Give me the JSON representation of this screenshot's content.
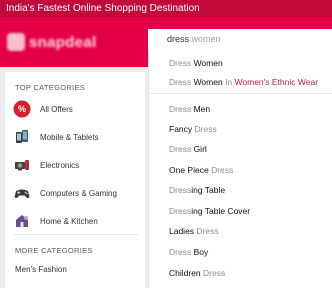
{
  "topbar": {
    "tagline": "India's Fastest Online Shopping Destination"
  },
  "brand": {
    "logo_text": "snapdeal"
  },
  "sidebar": {
    "top_heading": "TOP CATEGORIES",
    "categories": [
      {
        "label": "All Offers",
        "icon": "percent-offer-icon"
      },
      {
        "label": "Mobile & Tablets",
        "icon": "mobile-phone-icon"
      },
      {
        "label": "Electronics",
        "icon": "electronics-icon"
      },
      {
        "label": "Computers & Gaming",
        "icon": "gamepad-icon"
      },
      {
        "label": "Home & Kitchen",
        "icon": "home-kitchen-icon"
      }
    ],
    "more_heading": "MORE CATEGORIES",
    "more_items": [
      "Men's Fashion"
    ]
  },
  "search": {
    "value": "dress",
    "typed": "dress",
    "completion": " women"
  },
  "suggestions": {
    "items": [
      {
        "parts": [
          {
            "t": "Dress",
            "s": "g"
          },
          {
            "t": " Women",
            "s": "b"
          }
        ]
      },
      {
        "parts": [
          {
            "t": "Dress",
            "s": "g"
          },
          {
            "t": " Women",
            "s": "b"
          },
          {
            "t": " In ",
            "s": "g"
          },
          {
            "t": "Women's Ethnic Wear",
            "s": "p"
          }
        ]
      },
      {
        "parts": [
          {
            "t": "Dress",
            "s": "g"
          },
          {
            "t": " Men",
            "s": "b"
          }
        ]
      },
      {
        "parts": [
          {
            "t": "Fancy",
            "s": "b"
          },
          {
            "t": " Dress",
            "s": "g"
          }
        ]
      },
      {
        "parts": [
          {
            "t": "Dress",
            "s": "g"
          },
          {
            "t": " Girl",
            "s": "b"
          }
        ]
      },
      {
        "parts": [
          {
            "t": "One Piece",
            "s": "b"
          },
          {
            "t": " Dress",
            "s": "g"
          }
        ]
      },
      {
        "parts": [
          {
            "t": "Dress",
            "s": "g"
          },
          {
            "t": "ing Table",
            "s": "b"
          }
        ]
      },
      {
        "parts": [
          {
            "t": "Dress",
            "s": "g"
          },
          {
            "t": "ing Table Cover",
            "s": "b"
          }
        ]
      },
      {
        "parts": [
          {
            "t": "Ladies",
            "s": "b"
          },
          {
            "t": " Dress",
            "s": "g"
          }
        ]
      },
      {
        "parts": [
          {
            "t": "Dress",
            "s": "g"
          },
          {
            "t": " Boy",
            "s": "b"
          }
        ]
      },
      {
        "parts": [
          {
            "t": "Children",
            "s": "b"
          },
          {
            "t": " Dress",
            "s": "g"
          }
        ]
      }
    ]
  },
  "colors": {
    "brand": "#e40046",
    "topbar": "#c3083c",
    "category_link": "#c2185b"
  }
}
